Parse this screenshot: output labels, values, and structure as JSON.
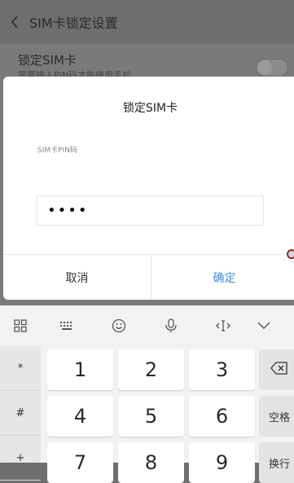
{
  "topbar": {
    "title": "SIM卡锁定设置"
  },
  "setting": {
    "title": "锁定SIM卡",
    "subtitle": "需要输入PIN码才能使用手机"
  },
  "dialog": {
    "title": "锁定SIM卡",
    "field_label": "SIM卡PIN码",
    "pin_value": "••••",
    "cancel_label": "取消",
    "confirm_label": "确定",
    "confirm_color": "#3d8fe3"
  },
  "keyboard": {
    "toolbar_icons": [
      "grid-icon",
      "keyboard-icon",
      "emoji-icon",
      "microphone-icon",
      "cursor-icon",
      "collapse-icon"
    ],
    "symbols": [
      "*",
      "#",
      "+"
    ],
    "keys": [
      "1",
      "2",
      "3",
      "4",
      "5",
      "6",
      "7",
      "8",
      "9"
    ],
    "space_label": "空格",
    "enter_label": "换行"
  }
}
